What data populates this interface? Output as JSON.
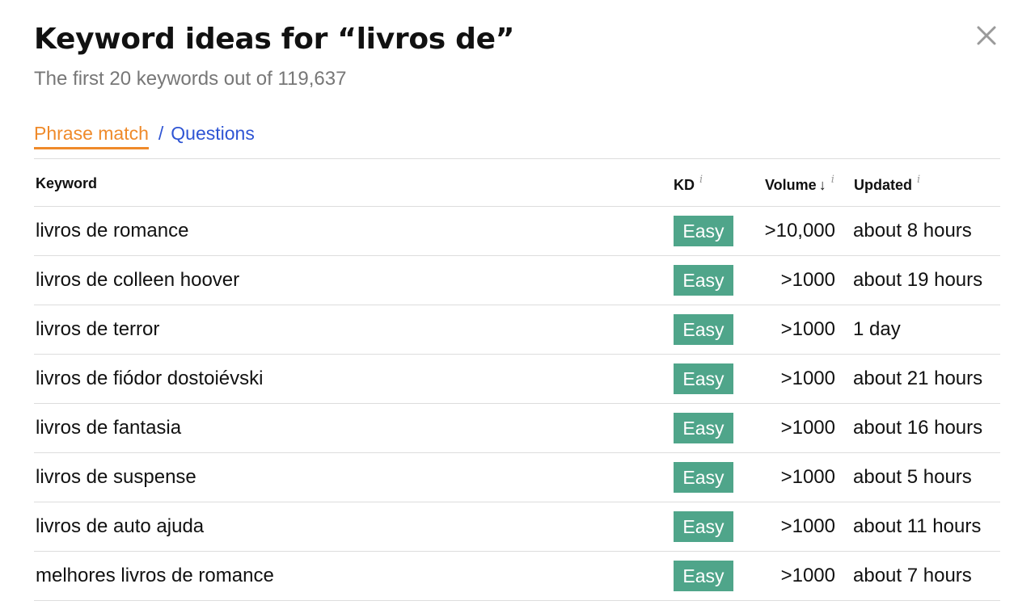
{
  "header": {
    "title": "Keyword ideas for “livros de”",
    "subtitle": "The first 20 keywords out of 119,637",
    "close_icon": "close-icon"
  },
  "tabs": {
    "phrase_match": "Phrase match",
    "separator": "/",
    "questions": "Questions",
    "active": "phrase_match"
  },
  "table": {
    "columns": {
      "keyword": "Keyword",
      "kd": "KD",
      "volume": "Volume",
      "updated": "Updated",
      "info_marker": "i",
      "sort_arrow": "↓"
    },
    "rows": [
      {
        "keyword": "livros de romance",
        "kd": "Easy",
        "volume": ">10,000",
        "updated": "about 8 hours"
      },
      {
        "keyword": "livros de colleen hoover",
        "kd": "Easy",
        "volume": ">1000",
        "updated": "about 19 hours"
      },
      {
        "keyword": "livros de terror",
        "kd": "Easy",
        "volume": ">1000",
        "updated": "1 day"
      },
      {
        "keyword": "livros de fiódor dostoiévski",
        "kd": "Easy",
        "volume": ">1000",
        "updated": "about 21 hours"
      },
      {
        "keyword": "livros de fantasia",
        "kd": "Easy",
        "volume": ">1000",
        "updated": "about 16 hours"
      },
      {
        "keyword": "livros de suspense",
        "kd": "Easy",
        "volume": ">1000",
        "updated": "about 5 hours"
      },
      {
        "keyword": "livros de auto ajuda",
        "kd": "Easy",
        "volume": ">1000",
        "updated": "about 11 hours"
      },
      {
        "keyword": "melhores livros de romance",
        "kd": "Easy",
        "volume": ">1000",
        "updated": "about 7 hours"
      }
    ]
  },
  "colors": {
    "accent_orange": "#ef8a2a",
    "link_blue": "#2f55d4",
    "kd_easy_green": "#4fa58a",
    "subtitle_gray": "#777777"
  }
}
